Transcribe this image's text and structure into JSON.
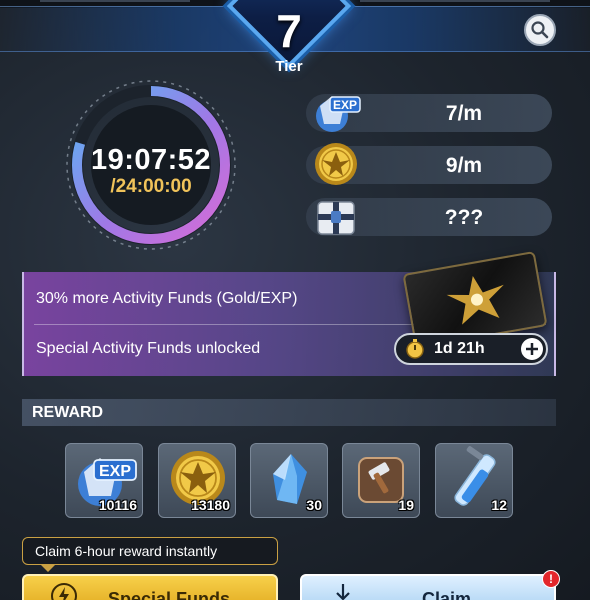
{
  "tier": {
    "number": "7",
    "label": "Tier"
  },
  "timer": {
    "elapsed": "19:07:52",
    "total": "/24:00:00",
    "progress": 0.797
  },
  "rates": [
    {
      "icon": "exp-icon",
      "value": "7/m"
    },
    {
      "icon": "gold-coin-icon",
      "value": "9/m"
    },
    {
      "icon": "mystery-chest-icon",
      "value": "???"
    }
  ],
  "bonus": {
    "line1": "30% more Activity Funds (Gold/EXP)",
    "line2": "Special Activity Funds unlocked",
    "duration": "1d 21h"
  },
  "reward": {
    "title": "REWARD",
    "items": [
      {
        "icon": "exp-icon",
        "count": "10116"
      },
      {
        "icon": "gold-coin-icon",
        "count": "13180"
      },
      {
        "icon": "blue-crystal-icon",
        "count": "30"
      },
      {
        "icon": "hammer-icon",
        "count": "19"
      },
      {
        "icon": "tube-vial-icon",
        "count": "12"
      }
    ]
  },
  "tooltip": "Claim 6-hour reward instantly",
  "buttons": {
    "special": "Special Funds",
    "claim": "Claim",
    "claim_badge": "!"
  },
  "icon_texts": {
    "exp": "EXP"
  },
  "colors": {
    "accent_blue": "#5aa8f0",
    "gold": "#f0c35a",
    "purple": "#8a4fb0",
    "alert_red": "#e3262b"
  }
}
